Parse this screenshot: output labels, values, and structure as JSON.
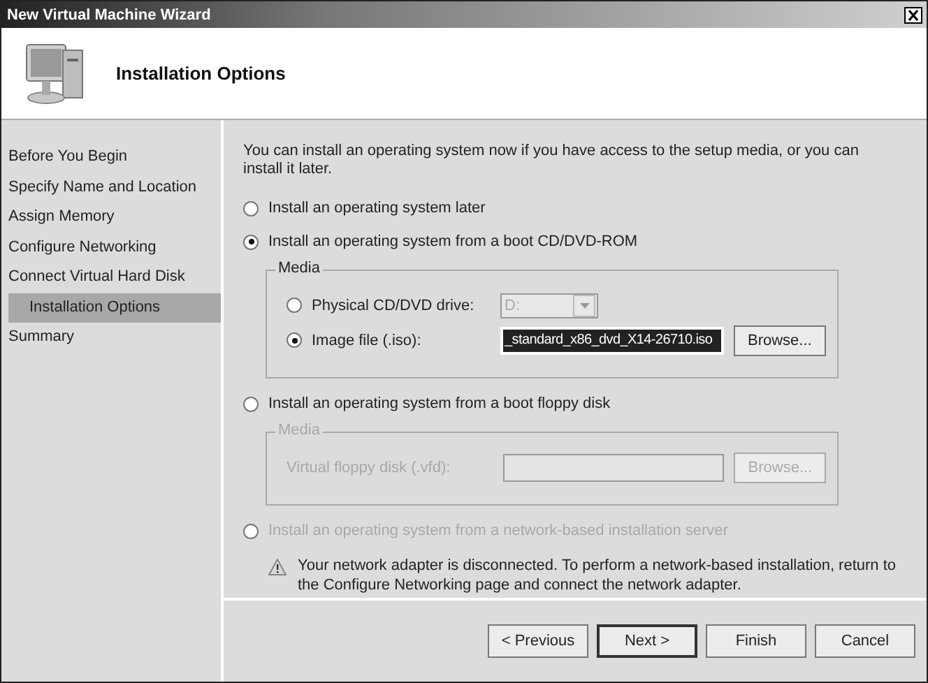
{
  "window": {
    "title": "New Virtual Machine Wizard"
  },
  "header": {
    "title": "Installation Options"
  },
  "sidebar": {
    "items": [
      {
        "label": "Before You Begin",
        "selected": false
      },
      {
        "label": "Specify Name and Location",
        "selected": false
      },
      {
        "label": "Assign Memory",
        "selected": false
      },
      {
        "label": "Configure Networking",
        "selected": false
      },
      {
        "label": "Connect Virtual Hard Disk",
        "selected": false
      },
      {
        "label": "Installation Options",
        "selected": true
      },
      {
        "label": "Summary",
        "selected": false
      }
    ]
  },
  "intro": "You can install an operating system now if you have access to the setup media, or you can install it later.",
  "options": [
    {
      "label": "Install an operating system later",
      "selected": false,
      "disabled": false
    },
    {
      "label": "Install an operating system from a boot CD/DVD-ROM",
      "selected": true,
      "disabled": false,
      "media": {
        "legend": "Media",
        "disabled": false,
        "rows": [
          {
            "kind": "radio-dropdown",
            "label": "Physical CD/DVD drive:",
            "selected": false,
            "value": "D:"
          },
          {
            "kind": "radio-file",
            "label": "Image file (.iso):",
            "selected": true,
            "value": "_standard_x86_dvd_X14-26710.iso",
            "button": "Browse..."
          }
        ]
      }
    },
    {
      "label": "Install an operating system from a boot floppy disk",
      "selected": false,
      "disabled": false,
      "media": {
        "legend": "Media",
        "disabled": true,
        "rows": [
          {
            "kind": "file",
            "label": "Virtual floppy disk (.vfd):",
            "button": "Browse..."
          }
        ]
      }
    },
    {
      "label": "Install an operating system from a network-based installation server",
      "selected": false,
      "disabled": true,
      "warning": "Your network adapter is disconnected. To perform a network-based installation, return to the Configure Networking page and connect the network adapter."
    }
  ],
  "buttons": [
    {
      "label": "< Previous",
      "default": false
    },
    {
      "label": "Next >",
      "default": true
    },
    {
      "label": "Finish",
      "default": false
    },
    {
      "label": "Cancel",
      "default": false
    }
  ]
}
